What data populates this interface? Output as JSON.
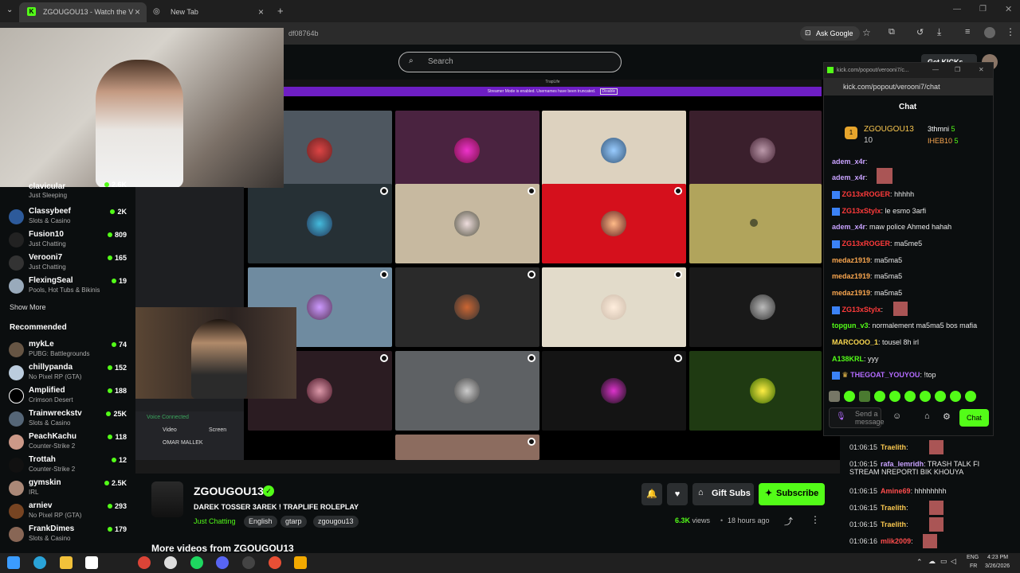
{
  "browser": {
    "tabs": [
      {
        "label": "ZGOUGOU13 - Watch the V"
      },
      {
        "label": "New Tab"
      }
    ],
    "url_fragment": "df08764b",
    "ask_google": "Ask Google"
  },
  "site": {
    "search_placeholder": "Search",
    "get_kicks": "Get KICKs"
  },
  "stream_banner": {
    "title": "TrapLife",
    "notice": "Streamer Mode is enabled. Usernames have been truncated.",
    "disable": "Disable"
  },
  "sidebar": {
    "partial_channel": {
      "name": "clavicular",
      "category": "Just Sleeping",
      "viewers": "2.6K"
    },
    "followed": [
      {
        "name": "Classybeef",
        "category": "Slots & Casino",
        "viewers": "2K"
      },
      {
        "name": "Fusion10",
        "category": "Just Chatting",
        "viewers": "809"
      },
      {
        "name": "Verooni7",
        "category": "Just Chatting",
        "viewers": "165"
      },
      {
        "name": "FlexingSeal",
        "category": "Pools, Hot Tubs & Bikinis",
        "viewers": "19"
      }
    ],
    "show_more": "Show More",
    "recommended_title": "Recommended",
    "recommended": [
      {
        "name": "mykLe",
        "category": "PUBG: Battlegrounds",
        "viewers": "74"
      },
      {
        "name": "chillypanda",
        "category": "No Pixel RP (GTA)",
        "viewers": "152"
      },
      {
        "name": "Amplified",
        "category": "Crimson Desert",
        "viewers": "188"
      },
      {
        "name": "Trainwreckstv",
        "category": "Slots & Casino",
        "viewers": "25K"
      },
      {
        "name": "PeachKachu",
        "category": "Counter-Strike 2",
        "viewers": "118"
      },
      {
        "name": "Trottah",
        "category": "Counter-Strike 2",
        "viewers": "12"
      },
      {
        "name": "gymskin",
        "category": "IRL",
        "viewers": "2.5K"
      },
      {
        "name": "arniev",
        "category": "No Pixel RP (GTA)",
        "viewers": "293"
      },
      {
        "name": "FrankDimes",
        "category": "Slots & Casino",
        "viewers": "179"
      }
    ]
  },
  "chat_popout": {
    "window_url": "kick.com/popout/verooni7/c...",
    "address": "kick.com/popout/verooni7/chat",
    "header": "Chat",
    "top_gifters": [
      {
        "name": "ZGOUGOU13",
        "count": "10"
      },
      {
        "name": "3thmni",
        "count": "5"
      },
      {
        "name": "IHEB10",
        "count": "5"
      }
    ],
    "messages": [
      {
        "user": "adem_x4r",
        "text": ""
      },
      {
        "user": "adem_x4r",
        "text": ""
      },
      {
        "user": "ZG13xROGER",
        "text": "hhhhh"
      },
      {
        "user": "ZG13xStylx",
        "text": "le esmo 3arfi"
      },
      {
        "user": "adem_x4r",
        "text": "maw police Ahmed hahah"
      },
      {
        "user": "ZG13xROGER",
        "text": "ma5me5"
      },
      {
        "user": "medaz1919",
        "text": "ma5ma5"
      },
      {
        "user": "medaz1919",
        "text": "ma5ma5"
      },
      {
        "user": "medaz1919",
        "text": "ma5ma5"
      },
      {
        "user": "ZG13xStylx",
        "text": ""
      },
      {
        "user": "topgun_v3",
        "text": "normalement ma5ma5 bos mafia"
      },
      {
        "user": "MARCOOO_1",
        "text": "tousel 8h irl"
      },
      {
        "user": "A138KRL",
        "text": "yyy"
      },
      {
        "user": "THEGOAT_YOUYOU",
        "text": "!top"
      }
    ],
    "input_placeholder": "Send a message",
    "chat_button": "Chat"
  },
  "right_chat": [
    {
      "time": "01:06:15",
      "user": "Traelith",
      "text": ""
    },
    {
      "time": "01:06:15",
      "user": "rafa_lemridh",
      "text": "TRASH TALK FI STREAM NREPORTI BIK KHOUYA"
    },
    {
      "time": "01:06:15",
      "user": "Amine69",
      "text": "hhhhhhhh"
    },
    {
      "time": "01:06:15",
      "user": "Traelith",
      "text": ""
    },
    {
      "time": "01:06:15",
      "user": "Traelith",
      "text": ""
    },
    {
      "time": "01:06:16",
      "user": "mlik2009",
      "text": ""
    }
  ],
  "stream_info": {
    "channel": "ZGOUGOU13",
    "title": "DAREK TOSSER 3AREK ! TRAPLIFE ROLEPLAY",
    "category": "Just Chatting",
    "tags": [
      "English",
      "gtarp",
      "zgougou13"
    ],
    "views": "6.3K",
    "views_label": "views",
    "time_ago": "18 hours ago",
    "gift_subs": "Gift Subs",
    "subscribe": "Subscribe",
    "more_videos": "More videos from ZGOUGOU13"
  },
  "discord_panel": {
    "voice_connected": "Voice Connected",
    "video": "Video",
    "screen": "Screen",
    "user": "OMAR MALLEK"
  },
  "taskbar": {
    "lang": "ENG",
    "region": "FR",
    "time": "4:23 PM",
    "date": "3/26/2026"
  },
  "colors": {
    "accent": "#53fc18",
    "purple": "#6e1ec4",
    "bg": "#0b0e0f"
  }
}
